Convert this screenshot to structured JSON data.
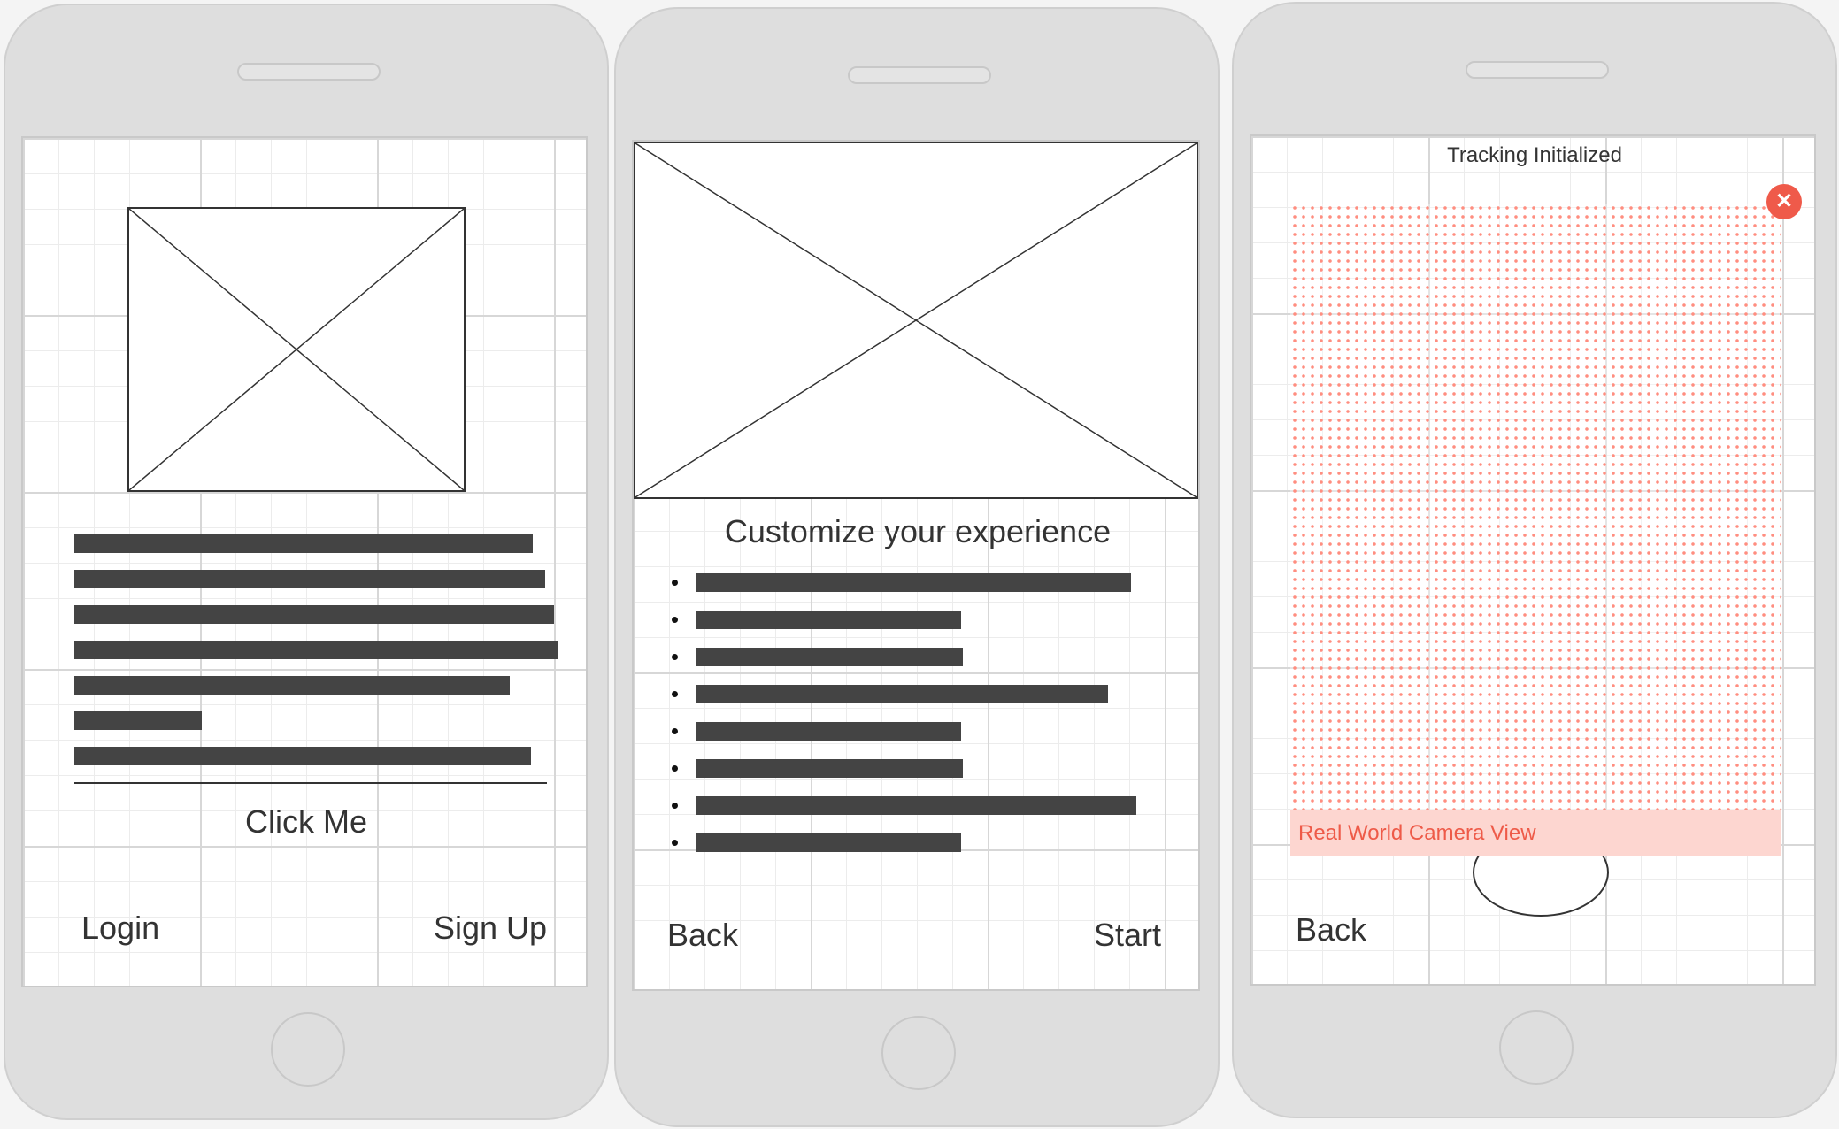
{
  "screen1": {
    "button_label": "Click Me",
    "login_label": "Login",
    "signup_label": "Sign Up"
  },
  "screen2": {
    "heading": "Customize your experience",
    "back_label": "Back",
    "start_label": "Start"
  },
  "screen3": {
    "status": "Tracking Initialized",
    "camera_label": "Real World Camera View",
    "close_icon": "close-icon",
    "back_label": "Back"
  },
  "colors": {
    "accent": "#ef5a4a",
    "label_bg": "#fdd6d0",
    "text_bar": "#444444",
    "device": "#dedede"
  }
}
